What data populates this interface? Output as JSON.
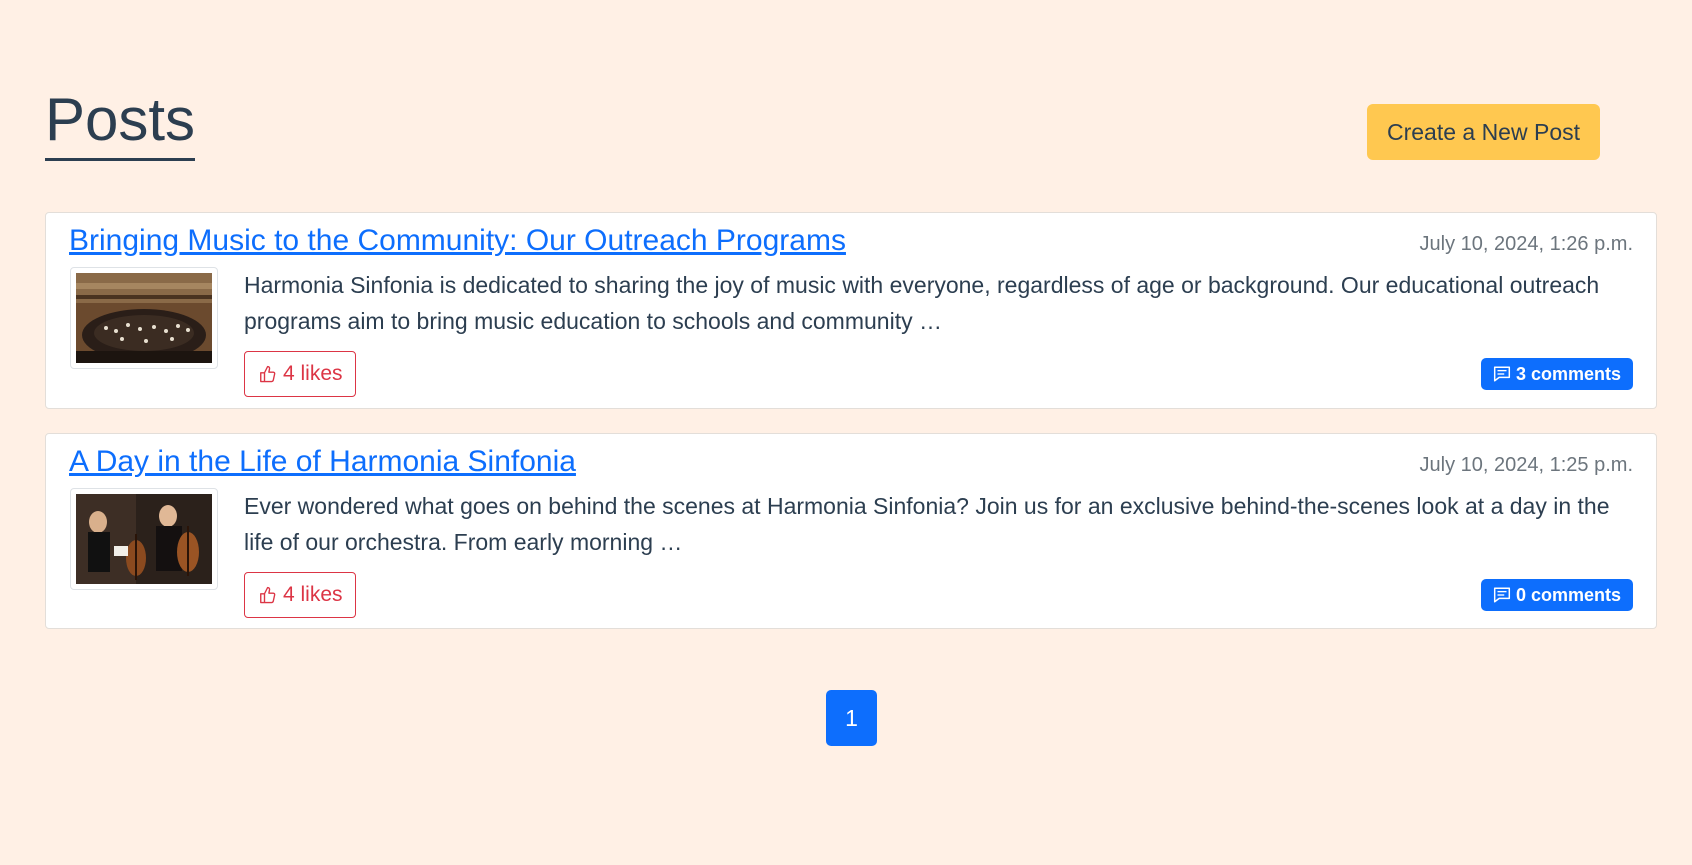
{
  "header": {
    "title": "Posts",
    "create_button": "Create a New Post"
  },
  "posts": [
    {
      "title": "Bringing Music to the Community: Our Outreach Programs",
      "date": "July 10, 2024, 1:26 p.m.",
      "excerpt": "Harmonia Sinfonia is dedicated to sharing the joy of music with everyone, regardless of age or background. Our educational outreach programs aim to bring music education to schools and community …",
      "likes": "4 likes",
      "comments": "3 comments",
      "thumbnail_icon": "concert-hall-photo"
    },
    {
      "title": "A Day in the Life of Harmonia Sinfonia",
      "date": "July 10, 2024, 1:25 p.m.",
      "excerpt": "Ever wondered what goes on behind the scenes at Harmonia Sinfonia? Join us for an exclusive behind-the-scenes look at a day in the life of our orchestra. From early morning …",
      "likes": "4 likes",
      "comments": "0 comments",
      "thumbnail_icon": "cellists-photo"
    }
  ],
  "pagination": {
    "current_page": "1"
  },
  "colors": {
    "background": "#fff0e5",
    "accent": "#0d6efd",
    "create_button": "#ffc850",
    "likes": "#dc3545"
  }
}
